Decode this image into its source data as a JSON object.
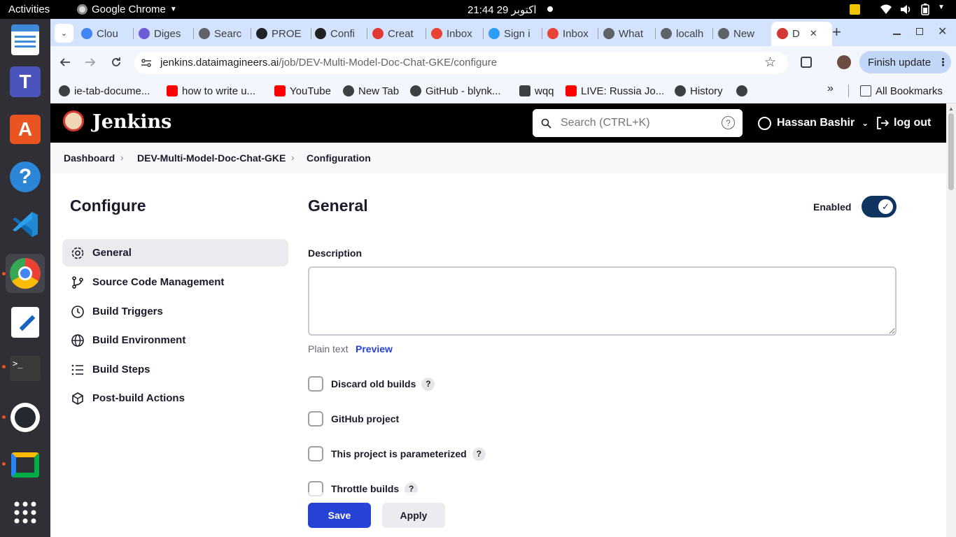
{
  "system": {
    "activities": "Activities",
    "app_name": "Google Chrome",
    "clock": "21:44  29 اکتوبر"
  },
  "tabs": [
    {
      "label": "Clou",
      "icon": "google-cloud-icon",
      "color": "#4285f4"
    },
    {
      "label": "Diges",
      "icon": "digest-icon",
      "color": "#6e5bd6"
    },
    {
      "label": "Searc",
      "icon": "settings-icon",
      "color": "#5f6368"
    },
    {
      "label": "PROE",
      "icon": "github-icon",
      "color": "#1f2328"
    },
    {
      "label": "Confi",
      "icon": "openai-icon",
      "color": "#202123"
    },
    {
      "label": "Creat",
      "icon": "create-icon",
      "color": "#e53935"
    },
    {
      "label": "Inbox",
      "icon": "gmail-icon",
      "color": "#ea4335"
    },
    {
      "label": "Sign i",
      "icon": "cloud-icon",
      "color": "#2a9df4"
    },
    {
      "label": "Inbox",
      "icon": "gmail-icon",
      "color": "#ea4335"
    },
    {
      "label": "What",
      "icon": "globe-icon",
      "color": "#5f6368"
    },
    {
      "label": "localh",
      "icon": "globe-icon",
      "color": "#5f6368"
    },
    {
      "label": "New",
      "icon": "globe-icon",
      "color": "#5f6368"
    },
    {
      "label": "D",
      "icon": "jenkins-icon",
      "color": "#d33833",
      "active": true
    }
  ],
  "url": {
    "host": "jenkins.dataimagineers.ai",
    "path": "/job/DEV-Multi-Model-Doc-Chat-GKE/configure"
  },
  "finish_update": "Finish update",
  "bookmarks": [
    {
      "label": "ie-tab-docume...",
      "icon": "ie-tab-icon",
      "color": "#3c4043"
    },
    {
      "label": "how to write u...",
      "icon": "youtube-icon",
      "color": "#ff0000"
    },
    {
      "label": "YouTube",
      "icon": "youtube-icon",
      "color": "#ff0000"
    },
    {
      "label": "New Tab",
      "icon": "globe-icon",
      "color": "#3c4043"
    },
    {
      "label": "GitHub - blynk...",
      "icon": "github-icon",
      "color": "#3c4043"
    },
    {
      "label": "wqq",
      "icon": "download-icon",
      "color": "#3c4043"
    },
    {
      "label": "LIVE: Russia Jo...",
      "icon": "youtube-icon",
      "color": "#ff0000"
    },
    {
      "label": "History",
      "icon": "history-icon",
      "color": "#3c4043"
    }
  ],
  "all_bookmarks": "All Bookmarks",
  "jenkins": {
    "brand": "Jenkins",
    "search_placeholder": "Search (CTRL+K)",
    "help_symbol": "?",
    "user_name": "Hassan Bashir",
    "logout": "log out"
  },
  "breadcrumbs": [
    "Dashboard",
    "DEV-Multi-Model-Doc-Chat-GKE",
    "Configuration"
  ],
  "sidebar": {
    "title": "Configure",
    "items": [
      {
        "label": "General",
        "icon": "gear-icon",
        "active": true
      },
      {
        "label": "Source Code Management",
        "icon": "branch-icon"
      },
      {
        "label": "Build Triggers",
        "icon": "clock-icon"
      },
      {
        "label": "Build Environment",
        "icon": "globe-icon"
      },
      {
        "label": "Build Steps",
        "icon": "list-icon"
      },
      {
        "label": "Post-build Actions",
        "icon": "package-icon"
      }
    ]
  },
  "general": {
    "title": "General",
    "enabled_label": "Enabled",
    "enabled": true,
    "description_label": "Description",
    "description_value": "",
    "plain_text": "Plain text",
    "preview": "Preview",
    "options": [
      {
        "label": "Discard old builds",
        "help": "?",
        "checked": false
      },
      {
        "label": "GitHub project",
        "help": "",
        "checked": false
      },
      {
        "label": "This project is parameterized",
        "help": "?",
        "checked": false
      },
      {
        "label": "Throttle builds",
        "help": "?",
        "checked": false
      }
    ]
  },
  "actions": {
    "save": "Save",
    "apply": "Apply"
  },
  "colors": {
    "accent": "#2542d4",
    "toggle": "#0f3460",
    "tabbar": "#d3e3fd",
    "header": "#000000"
  }
}
